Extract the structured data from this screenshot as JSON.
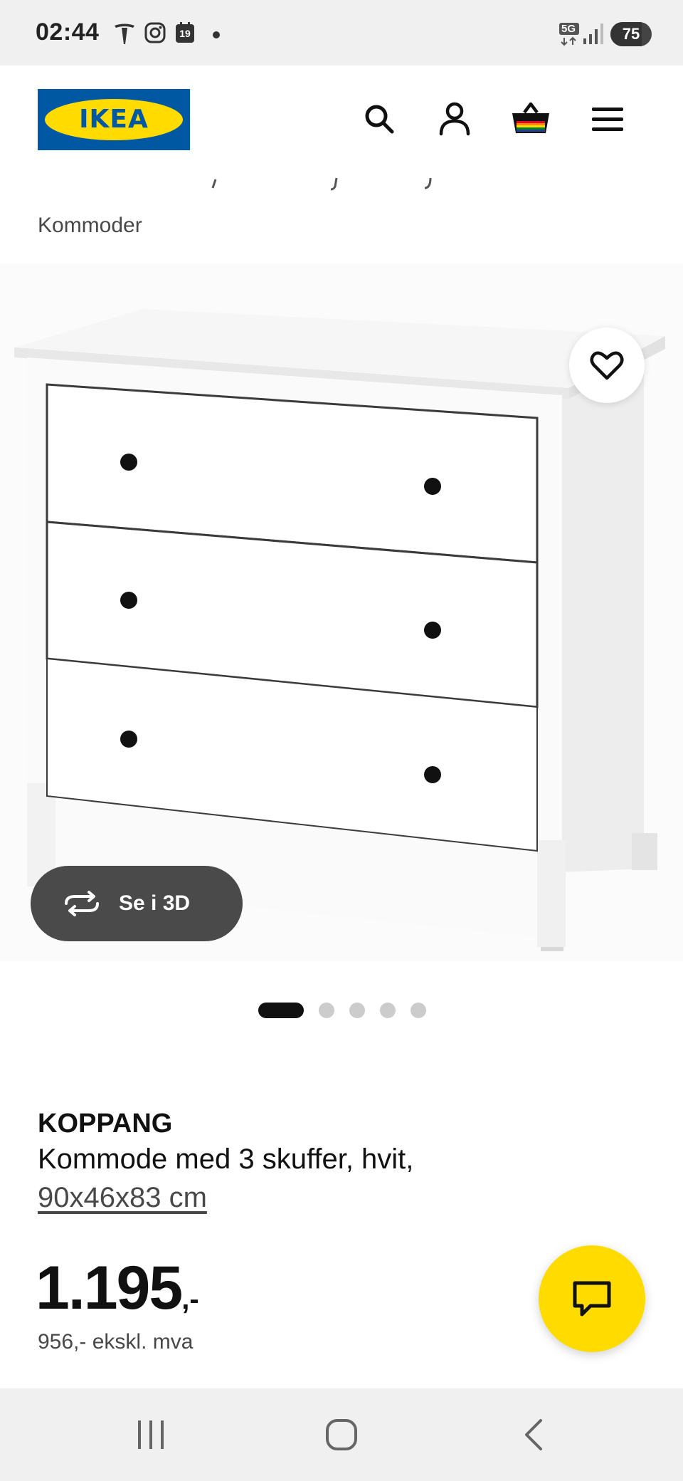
{
  "status_bar": {
    "time": "02:44",
    "icons": [
      "tesla-icon",
      "instagram-icon",
      "calendar-icon",
      "notification-dot-icon",
      "5g-icon",
      "signal-icon"
    ],
    "calendar_day": "19",
    "network": "5G",
    "battery": "75",
    "battery_level": 0.75
  },
  "header": {
    "logo_text": "IKEA",
    "icons": [
      "search-icon",
      "user-icon",
      "cart-icon",
      "menu-icon"
    ],
    "logo_colors": {
      "blue": "#0058a3",
      "yellow": "#ffdb00"
    }
  },
  "breadcrumb": {
    "current": "Kommoder"
  },
  "gallery": {
    "view_3d_label": "Se i 3D",
    "page_count": 5,
    "active_page": 1
  },
  "product": {
    "name": "KOPPANG",
    "description": "Kommode med 3 skuffer, hvit,",
    "dimensions": "90x46x83 cm",
    "price": "1.195",
    "price_suffix": ",-",
    "price_ex_vat": "956,- ekskl. mva"
  },
  "chat": {
    "icon": "chat-icon",
    "color": "#ffdb00"
  },
  "navbar": {
    "icons": [
      "recent-apps-icon",
      "home-icon",
      "back-icon"
    ]
  }
}
